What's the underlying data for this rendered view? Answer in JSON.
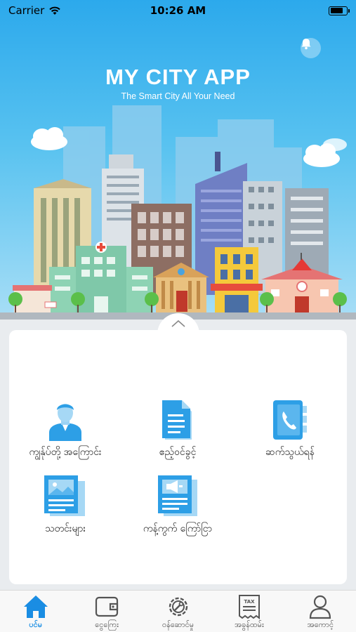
{
  "status_bar": {
    "carrier": "Carrier",
    "time": "10:26 AM",
    "battery_level": 0.85
  },
  "header": {
    "title": "MY CITY APP",
    "subtitle": "The Smart City All Your Need"
  },
  "menu": [
    {
      "label": "ကျွန်ုပ်တို့ အကြောင်း",
      "icon": "person-icon"
    },
    {
      "label": "ဧည့်ဝင်ခွင့်",
      "icon": "document-icon"
    },
    {
      "label": "ဆက်သွယ်ရန်",
      "icon": "contact-book-icon"
    },
    {
      "label": "သတင်းများ",
      "icon": "news-icon"
    },
    {
      "label": "ကန့်ကွက် ကြော်ငြာ",
      "icon": "megaphone-icon"
    }
  ],
  "tabs": [
    {
      "label": "ပင်မ",
      "icon": "home-icon",
      "active": true
    },
    {
      "label": "ငွေကြေး",
      "icon": "wallet-icon",
      "active": false
    },
    {
      "label": "ဝန်ဆောင်မှု",
      "icon": "service-gear-icon",
      "active": false
    },
    {
      "label": "အခွန်ထမ်း",
      "icon": "tax-receipt-icon",
      "active": false
    },
    {
      "label": "အကောင့်",
      "icon": "account-icon",
      "active": false
    }
  ],
  "colors": {
    "accent": "#1a8de3",
    "sky": "#2ca9ec",
    "icon_blue": "#2d9fe6",
    "icon_light": "#a6d8f5"
  }
}
